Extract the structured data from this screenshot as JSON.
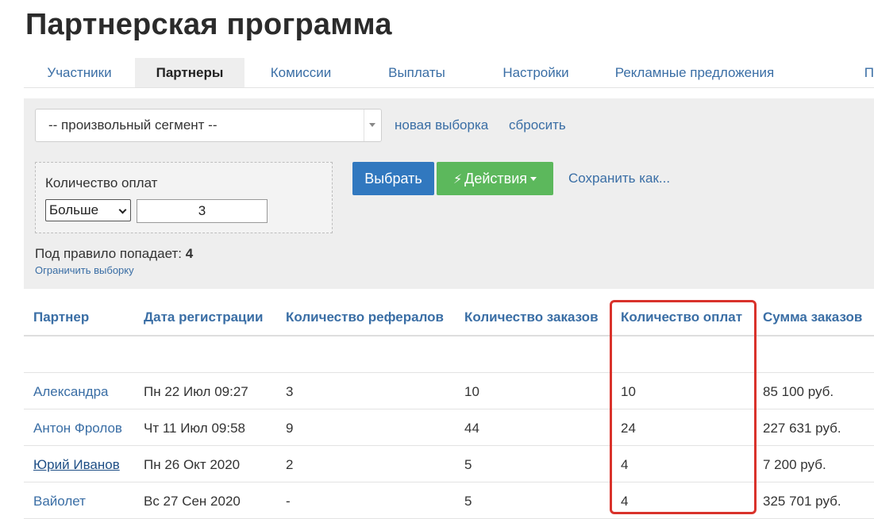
{
  "page": {
    "title": "Партнерская программа"
  },
  "tabs": [
    {
      "label": "Участники",
      "active": false
    },
    {
      "label": "Партнеры",
      "active": true
    },
    {
      "label": "Комиссии",
      "active": false
    },
    {
      "label": "Выплаты",
      "active": false
    },
    {
      "label": "Настройки",
      "active": false
    },
    {
      "label": "Рекламные предложения",
      "active": false
    },
    {
      "label": "П",
      "active": false
    }
  ],
  "filter": {
    "segment_value": "-- произвольный сегмент --",
    "new_selection_label": "новая выборка",
    "reset_label": "сбросить",
    "rule": {
      "field_label": "Количество оплат",
      "operator": "Больше",
      "value": "3"
    },
    "select_button": "Выбрать",
    "actions_button": "Действия",
    "save_as_label": "Сохранить как...",
    "match_prefix": "Под правило попадает:",
    "match_count": "4",
    "limit_link": "Ограничить выборку"
  },
  "table": {
    "columns": [
      "Партнер",
      "Дата регистрации",
      "Количество рефералов",
      "Количество заказов",
      "Количество оплат",
      "Сумма заказов"
    ],
    "rows": [
      {
        "partner": "Александра",
        "registered": "Пн 22 Июл 09:27",
        "referrals": "3",
        "orders": "10",
        "payments": "10",
        "sum": "85 100 руб."
      },
      {
        "partner": "Антон Фролов",
        "registered": "Чт 11 Июл 09:58",
        "referrals": "9",
        "orders": "44",
        "payments": "24",
        "sum": "227 631 руб."
      },
      {
        "partner": "Юрий Иванов",
        "registered": "Пн 26 Окт 2020",
        "referrals": "2",
        "orders": "5",
        "payments": "4",
        "sum": "7 200 руб."
      },
      {
        "partner": "Вайолет",
        "registered": "Вс 27 Сен 2020",
        "referrals": "-",
        "orders": "5",
        "payments": "4",
        "sum": "325 701 руб."
      }
    ]
  },
  "colors": {
    "link": "#3a6ea5",
    "primary": "#3178bf",
    "success": "#5cb85c",
    "highlight": "#d9322b"
  }
}
